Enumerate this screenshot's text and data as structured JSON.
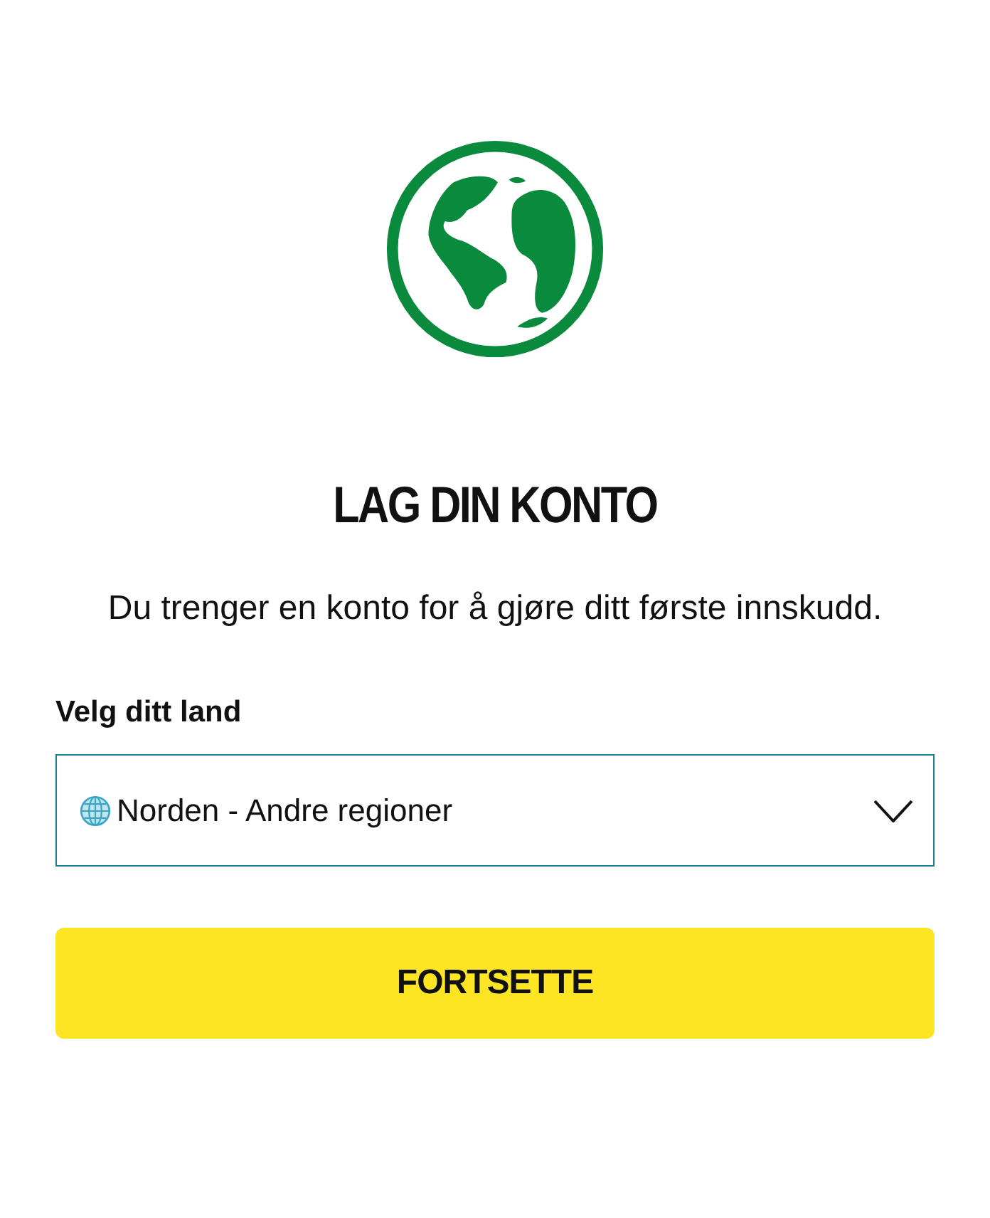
{
  "title": "LAG DIN KONTO",
  "description": "Du trenger en konto for å gjøre ditt første innskudd.",
  "country_select": {
    "label": "Velg ditt land",
    "value": "Norden - Andre regioner"
  },
  "button": "FORTSETTE"
}
